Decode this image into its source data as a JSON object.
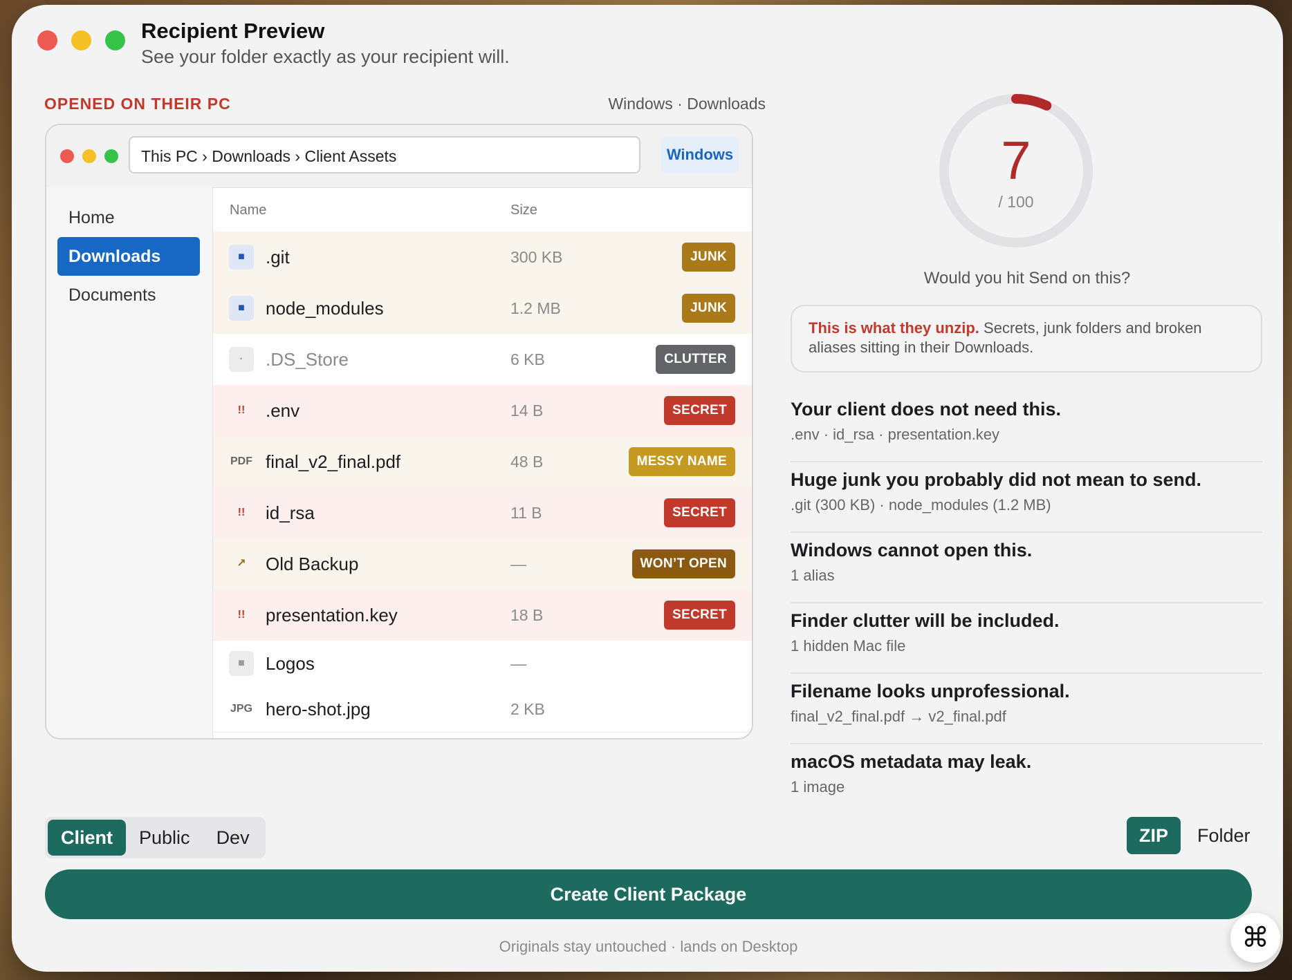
{
  "window": {
    "title": "Recipient Preview",
    "subtitle": "See your folder exactly as your recipient will."
  },
  "preview": {
    "section_label": "OPENED ON THEIR PC",
    "section_right": "Windows · Downloads",
    "address": "This PC › Downloads › Client Assets",
    "os_badge": "Windows",
    "sidebar": [
      "Home",
      "Downloads",
      "Documents"
    ],
    "active_sidebar": "Downloads",
    "columns": {
      "name": "Name",
      "size": "Size"
    },
    "files": [
      {
        "icon": "■",
        "name": ".git",
        "size": "300 KB",
        "tag": "JUNK",
        "tag_color": "#a9791a",
        "row_style": "junk"
      },
      {
        "icon": "■",
        "name": "node_modules",
        "size": "1.2 MB",
        "tag": "JUNK",
        "tag_color": "#a9791a",
        "row_style": "junk"
      },
      {
        "icon": "·",
        "name": ".DS_Store",
        "size": "6 KB",
        "tag": "CLUTTER",
        "tag_color": "#636468",
        "row_style": "white"
      },
      {
        "icon": "!!",
        "name": ".env",
        "size": "14 B",
        "tag": "SECRET",
        "tag_color": "#c0392b",
        "row_style": "secret"
      },
      {
        "icon": "PDF",
        "name": "final_v2_final.pdf",
        "size": "48 B",
        "tag": "MESSY NAME",
        "tag_color": "#c69a20",
        "row_style": "junk"
      },
      {
        "icon": "!!",
        "name": "id_rsa",
        "size": "11 B",
        "tag": "SECRET",
        "tag_color": "#c0392b",
        "row_style": "secret"
      },
      {
        "icon": "↗",
        "name": "Old Backup",
        "size": "—",
        "tag": "WON’T OPEN",
        "tag_color": "#8b5a10",
        "row_style": "junk"
      },
      {
        "icon": "!!",
        "name": "presentation.key",
        "size": "18 B",
        "tag": "SECRET",
        "tag_color": "#c0392b",
        "row_style": "secret"
      },
      {
        "icon": "■",
        "name": "Logos",
        "size": "—",
        "tag": "",
        "tag_color": "",
        "row_style": "white"
      },
      {
        "icon": "JPG",
        "name": "hero-shot.jpg",
        "size": "2 KB",
        "tag": "",
        "tag_color": "",
        "row_style": "white"
      }
    ]
  },
  "score": {
    "value": "7",
    "max": "/ 100",
    "fraction": 0.07,
    "color": "#b02a2a",
    "question": "Would you hit Send on this?"
  },
  "alert": {
    "strong": "This is what they unzip.",
    "text": " Secrets, junk folders and broken aliases sitting in their Downloads."
  },
  "issues": [
    {
      "title": "Your client does not need this.",
      "detail": ".env · id_rsa · presentation.key"
    },
    {
      "title": "Huge junk you probably did not mean to send.",
      "detail": ".git (300 KB) · node_modules (1.2 MB)"
    },
    {
      "title": "Windows cannot open this.",
      "detail": "1 alias"
    },
    {
      "title": "Finder clutter will be included.",
      "detail": "1 hidden Mac file"
    },
    {
      "title": "Filename looks unprofessional.",
      "detail": "final_v2_final.pdf → v2_final.pdf"
    },
    {
      "title": "macOS metadata may leak.",
      "detail": "1 image"
    }
  ],
  "audience": {
    "options": [
      "Client",
      "Public",
      "Dev"
    ],
    "selected": "Client"
  },
  "format": {
    "options": [
      "ZIP",
      "Folder"
    ],
    "selected": "ZIP"
  },
  "actions": {
    "create_label": "Create Client Package",
    "footnote": "Originals stay untouched · lands on Desktop",
    "fab_icon": "command-icon"
  },
  "colors": {
    "accent": "#1d6b5f",
    "selection": "#1767c4",
    "danger": "#c0392b"
  }
}
